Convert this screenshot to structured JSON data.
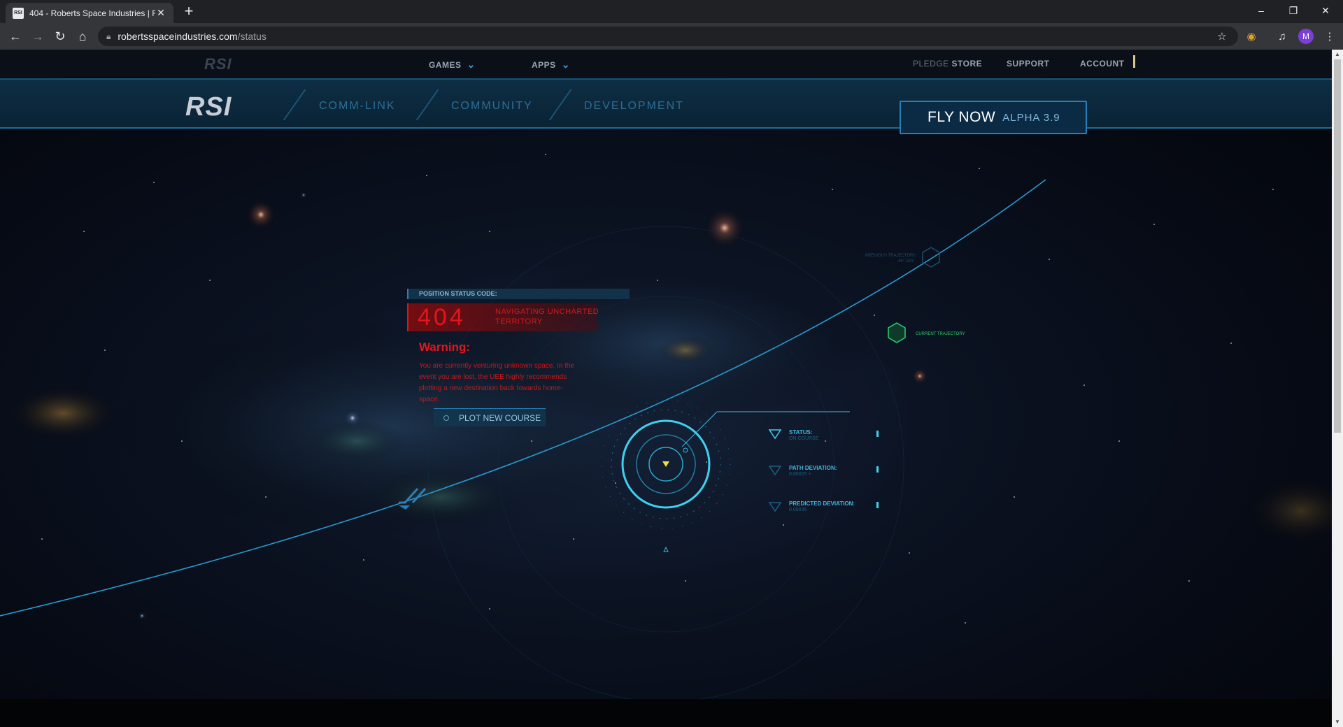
{
  "browser": {
    "tab_title": "404 - Roberts Space Industries | F",
    "tab_favicon_text": "RSI",
    "new_tab_symbol": "+",
    "url_domain": "robertsspaceindustries.com",
    "url_path": "/status",
    "profile_initial": "M",
    "window_controls": [
      "–",
      "❐",
      "✕"
    ]
  },
  "topnav": {
    "logo": "RSI",
    "games": "GAMES",
    "apps": "APPS",
    "pledge": "PLEDGE",
    "store": "STORE",
    "support": "SUPPORT",
    "account": "ACCOUNT"
  },
  "subnav": {
    "logo": "RSI",
    "links": [
      "COMM-LINK",
      "COMMUNITY",
      "DEVELOPMENT"
    ],
    "fly_now": "FLY NOW",
    "alpha": "ALPHA 3.9"
  },
  "status": {
    "header": "POSITION STATUS CODE:",
    "code": "404",
    "code_message": "NAVIGATING UNCHARTED TERRITORY",
    "warning_title": "Warning:",
    "warning_body": "You are currently venturing unknown space. In the event you are lost, the UEE highly recommends plotting a new destination back towards home-space.",
    "plot_button": "PLOT NEW COURSE"
  },
  "hud": {
    "status_label": "STATUS:",
    "status_value": "ON COURSE",
    "path_label": "PATH DEVIATION:",
    "path_value": "0.00025 +",
    "predicted_label": "PREDICTED DEVIATION:",
    "predicted_value": "0.00035",
    "previous_trajectory": "PREVIOUS TRAJECTORY",
    "previous_sub": "-45° DAY",
    "current_trajectory": "CURRENT TRAJECTORY"
  },
  "colors": {
    "accent": "#3aa3d8",
    "error": "#e3161b",
    "hud_cyan": "#3fd0f0",
    "trajectory_green": "#2fd06a"
  }
}
